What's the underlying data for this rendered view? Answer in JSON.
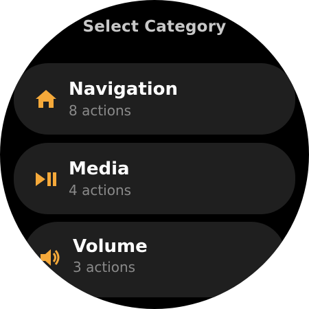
{
  "header": {
    "title": "Select Category"
  },
  "categories": [
    {
      "label": "Navigation",
      "count": "8 actions",
      "icon": "home-icon"
    },
    {
      "label": "Media",
      "count": "4 actions",
      "icon": "play-pause-icon"
    },
    {
      "label": "Volume",
      "count": "3 actions",
      "icon": "volume-icon"
    }
  ],
  "colors": {
    "accent": "#f5a93a",
    "chip_background": "#1f1f1f",
    "label": "#ffffff",
    "sublabel": "#8a8a8a",
    "title": "#c8c8c8"
  }
}
